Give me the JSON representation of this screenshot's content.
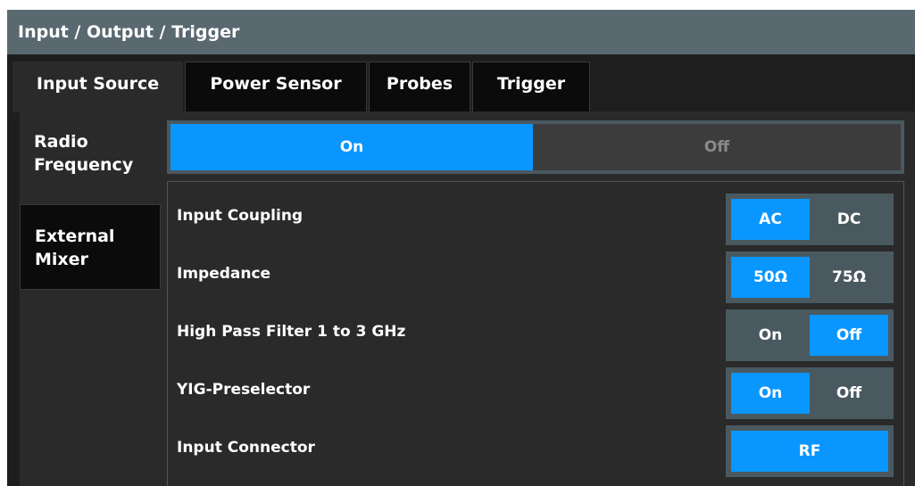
{
  "window": {
    "title": "Input / Output / Trigger"
  },
  "tabs": [
    {
      "label": "Input Source",
      "active": true
    },
    {
      "label": "Power Sensor",
      "active": false
    },
    {
      "label": "Probes",
      "active": false
    },
    {
      "label": "Trigger",
      "active": false
    }
  ],
  "side_tabs": [
    {
      "label": "Radio Frequency",
      "active": true
    },
    {
      "label": "External Mixer",
      "active": false
    }
  ],
  "rf_state": {
    "on_label": "On",
    "off_label": "Off",
    "selected": "On"
  },
  "settings": [
    {
      "label": "Input Coupling",
      "options": [
        "AC",
        "DC"
      ],
      "selected": "AC"
    },
    {
      "label": "Impedance",
      "options": [
        "50Ω",
        "75Ω"
      ],
      "selected": "50Ω"
    },
    {
      "label": "High Pass Filter 1 to 3 GHz",
      "options": [
        "On",
        "Off"
      ],
      "selected": "Off"
    },
    {
      "label": "YIG-Preselector",
      "options": [
        "On",
        "Off"
      ],
      "selected": "On"
    },
    {
      "label": "Input Connector",
      "options": [
        "RF"
      ],
      "selected": "RF"
    }
  ],
  "colors": {
    "accent": "#0a96ff",
    "title_bar": "#5a6870",
    "background": "#2a2a2a"
  }
}
